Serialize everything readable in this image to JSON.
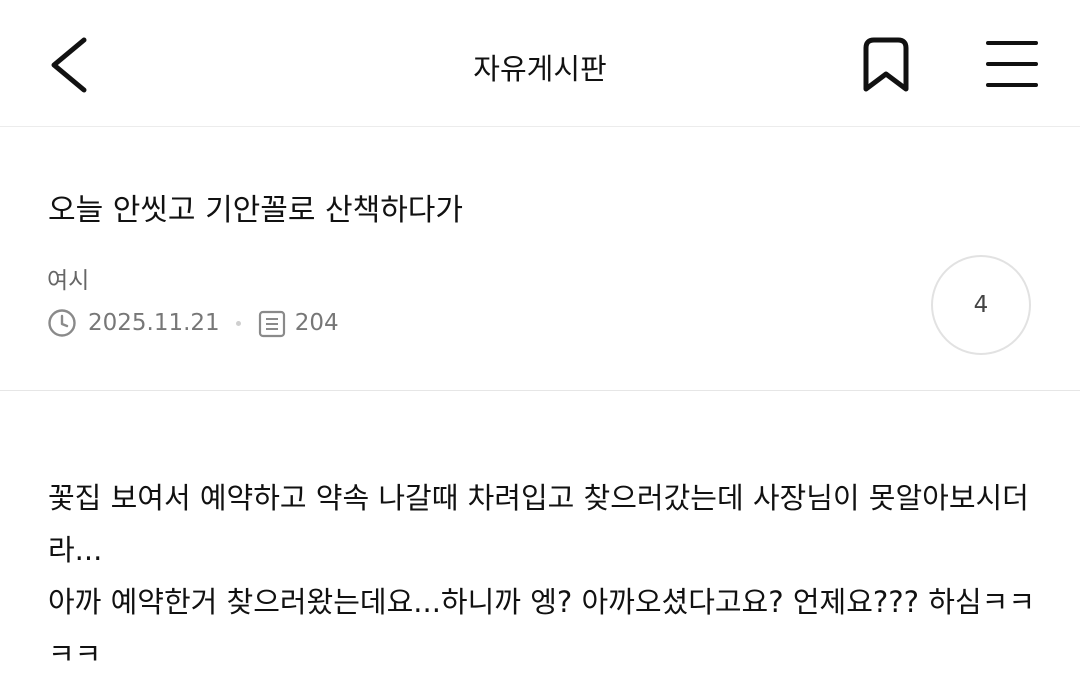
{
  "header": {
    "title": "자유게시판",
    "back_icon": "chevron-left-icon",
    "bookmark_icon": "bookmark-icon",
    "menu_icon": "hamburger-menu-icon"
  },
  "post": {
    "title": "오늘 안씻고 기안꼴로 산책하다가",
    "author": "여시",
    "date": "2025.11.21",
    "views": "204",
    "comment_count": "4",
    "body_lines": [
      "꽃집 보여서 예약하고 약속 나갈때 차려입고 찾으러갔는데 사장님이 못알아보시더라...",
      "아까 예약한거 찾으러왔는데요...하니까 엥? 아까오셨다고요? 언제요??? 하심ㅋㅋㅋㅋ"
    ]
  },
  "colors": {
    "text": "#111111",
    "meta": "#777777",
    "divider": "#e6e6e6"
  }
}
